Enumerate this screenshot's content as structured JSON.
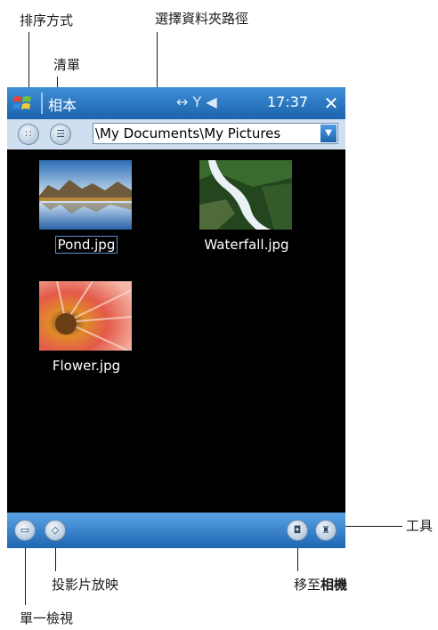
{
  "callouts": {
    "sort_mode": "排序方式",
    "folder_path": "選擇資料夾路徑",
    "list": "清單",
    "tools": "工具",
    "slideshow": "投影片放映",
    "go_to_camera_prefix": "移至",
    "go_to_camera_bold": "相機",
    "single_view": "單一檢視"
  },
  "titlebar": {
    "app_title": "相本",
    "clock": "17:37",
    "status": "↔ Y ◀"
  },
  "toolbar": {
    "path": "\\My Documents\\My Pictures"
  },
  "files": [
    {
      "name": "Pond.jpg",
      "selected": true
    },
    {
      "name": "Waterfall.jpg",
      "selected": false
    },
    {
      "name": "Flower.jpg",
      "selected": false
    }
  ],
  "colors": {
    "titlebar": "#1c63ad",
    "screen_bg": "#000000",
    "selection": "#5e8fd0"
  }
}
